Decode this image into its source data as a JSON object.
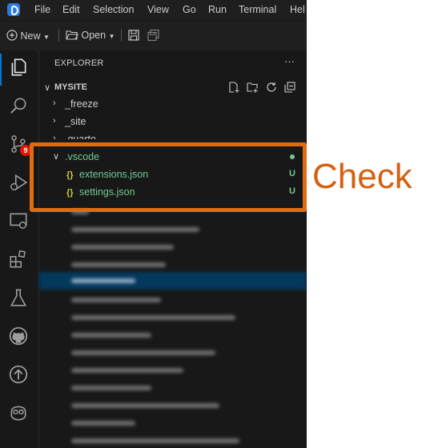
{
  "menubar": {
    "items": [
      "File",
      "Edit",
      "Selection",
      "View",
      "Go",
      "Run",
      "Terminal",
      "Hel"
    ]
  },
  "toolbar": {
    "new_label": "New",
    "open_label": "Open"
  },
  "activity_bar": {
    "items": [
      "explorer-icon",
      "search-icon",
      "source-control-icon",
      "run-debug-icon",
      "remote-explorer-icon",
      "extensions-icon",
      "testing-icon",
      "github-icon",
      "deploy-icon",
      "copilot-icon"
    ],
    "source_control_badge": "9"
  },
  "sidebar": {
    "title": "EXPLORER",
    "more": "···",
    "workspace": "MYSITE",
    "tree": [
      {
        "label": "_freeze",
        "type": "folder"
      },
      {
        "label": "_site",
        "type": "folder"
      },
      {
        "label": ".quarto",
        "type": "folder"
      },
      {
        "label": ".vscode",
        "type": "folder",
        "expanded": true,
        "status": "dot"
      },
      {
        "label": "extensions.json",
        "type": "file",
        "icon": "{}",
        "status": "U"
      },
      {
        "label": "settings.json",
        "type": "file",
        "icon": "{}",
        "status": "U"
      }
    ]
  },
  "annotation": {
    "text": "Check"
  },
  "colors": {
    "untracked": "#73c991",
    "highlight_border": "#e06c11",
    "annotation_text": "#d5600f",
    "json_icon": "#cbcb41",
    "selection": "#04395e",
    "accent": "#0078d4",
    "badge": "#e51400"
  }
}
